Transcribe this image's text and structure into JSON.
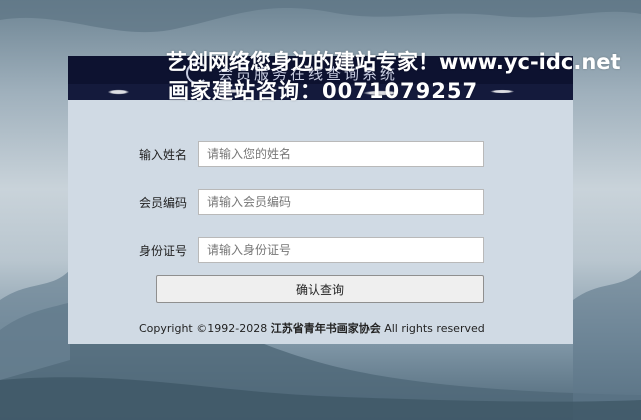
{
  "banner": {
    "title": "会员服务在线查询系统"
  },
  "watermark": {
    "line1": "艺创网络您身边的建站专家！www.yc-idc.net",
    "line2": "画家建站咨询：0071079257"
  },
  "form": {
    "name_label": "输入姓名",
    "name_placeholder": "请输入您的姓名",
    "id_label": "会员编码",
    "id_placeholder": "请输入会员编码",
    "card_label": "身份证号",
    "card_placeholder": "请输入身份证号",
    "submit_label": "确认查询"
  },
  "footer": {
    "prefix": "Copyright ©1992-2028 ",
    "org": "江苏省青年书画家协会",
    "suffix": " All rights reserved"
  },
  "colors": {
    "banner_bg": "#0d1230",
    "panel_bg": "#d0dae4",
    "page_bg": "#9fb0bc"
  }
}
